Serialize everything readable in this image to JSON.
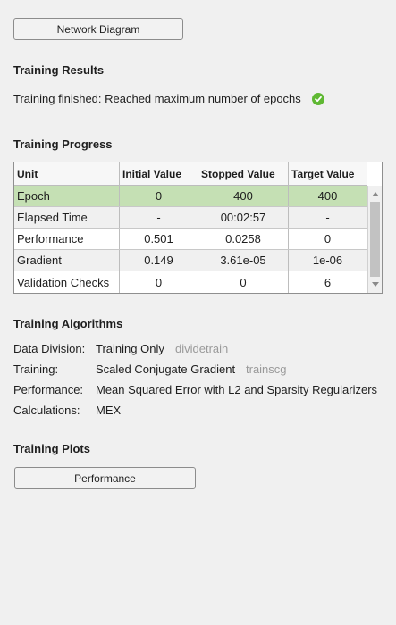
{
  "buttons": {
    "network_diagram": "Network Diagram",
    "performance_plot": "Performance"
  },
  "results": {
    "heading": "Training Results",
    "status": "Training finished: Reached maximum number of epochs",
    "status_icon": "checkmark-circle-icon",
    "status_color": "#5fb833"
  },
  "progress": {
    "heading": "Training Progress",
    "columns": [
      "Unit",
      "Initial Value",
      "Stopped Value",
      "Target Value"
    ],
    "rows": [
      {
        "unit": "Epoch",
        "initial": "0",
        "stopped": "400",
        "target": "400"
      },
      {
        "unit": "Elapsed Time",
        "initial": "-",
        "stopped": "00:02:57",
        "target": "-"
      },
      {
        "unit": "Performance",
        "initial": "0.501",
        "stopped": "0.0258",
        "target": "0"
      },
      {
        "unit": "Gradient",
        "initial": "0.149",
        "stopped": "3.61e-05",
        "target": "1e-06"
      },
      {
        "unit": "Validation Checks",
        "initial": "0",
        "stopped": "0",
        "target": "6"
      }
    ],
    "selected_row_color": "#c5e0b4"
  },
  "algorithms": {
    "heading": "Training Algorithms",
    "items": [
      {
        "label": "Data Division:",
        "value": "Training Only",
        "fn": "dividetrain"
      },
      {
        "label": "Training:",
        "value": "Scaled Conjugate Gradient",
        "fn": "trainscg"
      },
      {
        "label": "Performance:",
        "value": "Mean Squared Error with L2 and Sparsity Regularizers",
        "fn": ""
      },
      {
        "label": "Calculations:",
        "value": "MEX",
        "fn": ""
      }
    ]
  },
  "plots": {
    "heading": "Training Plots"
  }
}
